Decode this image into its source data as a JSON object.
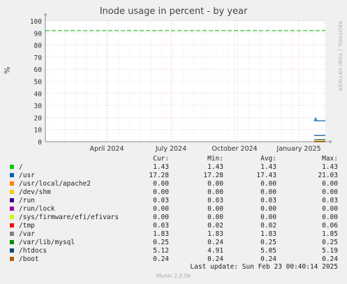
{
  "chart_data": {
    "type": "line",
    "title": "Inode usage in percent - by year",
    "ylabel": "%",
    "ylim": [
      0,
      100
    ],
    "yticks": [
      0,
      10,
      20,
      30,
      40,
      50,
      60,
      70,
      80,
      90,
      100
    ],
    "xticks": [
      "April 2024",
      "July 2024",
      "October 2024",
      "January 2025"
    ],
    "warning_level": 92,
    "series": [
      {
        "name": "/",
        "color": "#00cc00",
        "values": [
          1.43,
          1.43
        ]
      },
      {
        "name": "/usr",
        "color": "#0066b3",
        "values": [
          17.28,
          17.28
        ]
      },
      {
        "name": "/usr/local/apache2",
        "color": "#ff8000",
        "values": [
          0.0,
          0.0
        ]
      },
      {
        "name": "/dev/shm",
        "color": "#ffcc00",
        "values": [
          0.0,
          0.0
        ]
      },
      {
        "name": "/run",
        "color": "#330099",
        "values": [
          0.03,
          0.03
        ]
      },
      {
        "name": "/run/lock",
        "color": "#990099",
        "values": [
          0.0,
          0.0
        ]
      },
      {
        "name": "/sys/firmware/efi/efivars",
        "color": "#ccff00",
        "values": [
          0.0,
          0.0
        ]
      },
      {
        "name": "/tmp",
        "color": "#ff0000",
        "values": [
          0.03,
          0.03
        ]
      },
      {
        "name": "/var",
        "color": "#808080",
        "values": [
          1.83,
          1.83
        ]
      },
      {
        "name": "/var/lib/mysql",
        "color": "#008f00",
        "values": [
          0.25,
          0.25
        ]
      },
      {
        "name": "/htdocs",
        "color": "#00487d",
        "values": [
          5.12,
          5.12
        ]
      },
      {
        "name": "/boot",
        "color": "#b35a00",
        "values": [
          0.24,
          0.24
        ]
      }
    ]
  },
  "legend": {
    "headers": {
      "cur": "Cur:",
      "min": "Min:",
      "avg": "Avg:",
      "max": "Max:"
    },
    "rows": [
      {
        "name": "/",
        "color": "#00cc00",
        "cur": "1.43",
        "min": "1.43",
        "avg": "1.43",
        "max": "1.43"
      },
      {
        "name": "/usr",
        "color": "#0066b3",
        "cur": "17.28",
        "min": "17.28",
        "avg": "17.43",
        "max": "21.03"
      },
      {
        "name": "/usr/local/apache2",
        "color": "#ff8000",
        "cur": "0.00",
        "min": "0.00",
        "avg": "0.00",
        "max": "0.00"
      },
      {
        "name": "/dev/shm",
        "color": "#ffcc00",
        "cur": "0.00",
        "min": "0.00",
        "avg": "0.00",
        "max": "0.00"
      },
      {
        "name": "/run",
        "color": "#330099",
        "cur": "0.03",
        "min": "0.03",
        "avg": "0.03",
        "max": "0.03"
      },
      {
        "name": "/run/lock",
        "color": "#990099",
        "cur": "0.00",
        "min": "0.00",
        "avg": "0.00",
        "max": "0.00"
      },
      {
        "name": "/sys/firmware/efi/efivars",
        "color": "#ccff00",
        "cur": "0.00",
        "min": "0.00",
        "avg": "0.00",
        "max": "0.00"
      },
      {
        "name": "/tmp",
        "color": "#ff0000",
        "cur": "0.03",
        "min": "0.02",
        "avg": "0.02",
        "max": "0.06"
      },
      {
        "name": "/var",
        "color": "#808080",
        "cur": "1.83",
        "min": "1.83",
        "avg": "1.83",
        "max": "1.85"
      },
      {
        "name": "/var/lib/mysql",
        "color": "#008f00",
        "cur": "0.25",
        "min": "0.24",
        "avg": "0.25",
        "max": "0.25"
      },
      {
        "name": "/htdocs",
        "color": "#00487d",
        "cur": "5.12",
        "min": "4.91",
        "avg": "5.05",
        "max": "5.19"
      },
      {
        "name": "/boot",
        "color": "#b35a00",
        "cur": "0.24",
        "min": "0.24",
        "avg": "0.24",
        "max": "0.24"
      }
    ]
  },
  "footer": {
    "last_update": "Last update: Sun Feb 23 00:40:14 2025",
    "generator": "Munin 2.0.56",
    "watermark": "RRDTOOL / TOBI OETIKER"
  }
}
